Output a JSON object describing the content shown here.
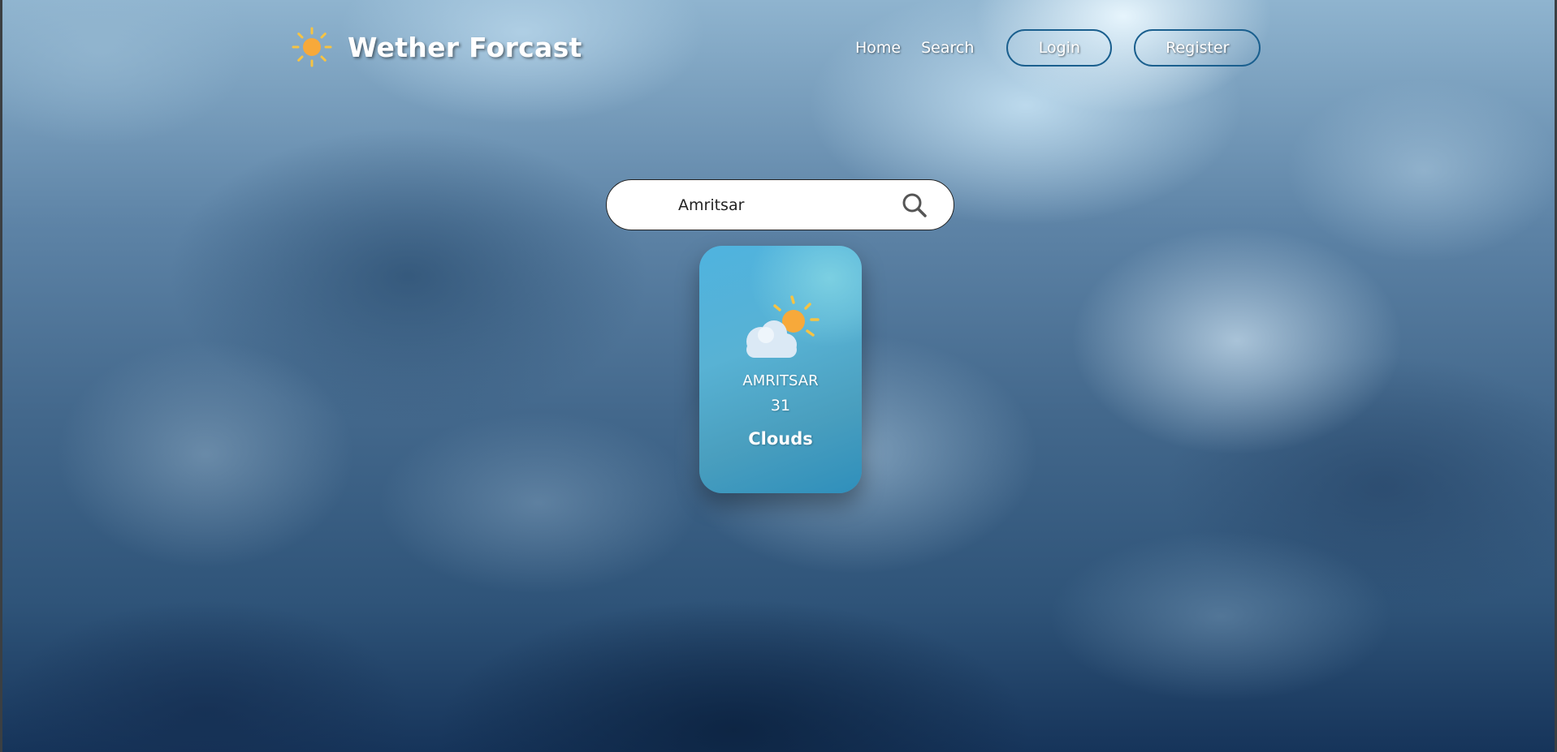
{
  "header": {
    "brand_title": "Wether Forcast",
    "brand_icon": "sun-icon",
    "nav": {
      "home_label": "Home",
      "search_label": "Search",
      "login_label": "Login",
      "register_label": "Register"
    }
  },
  "search": {
    "value": "Amritsar",
    "icon": "search-icon"
  },
  "weather_card": {
    "icon": "partly-cloudy-icon",
    "city": "AMRITSAR",
    "temperature": "31",
    "condition": "Clouds"
  },
  "colors": {
    "button_border": "#1a5f8e",
    "card_gradient_start": "#4fb3df",
    "card_gradient_end": "#2f8fbb",
    "sun": "#f7a93a",
    "text": "#ffffff"
  }
}
